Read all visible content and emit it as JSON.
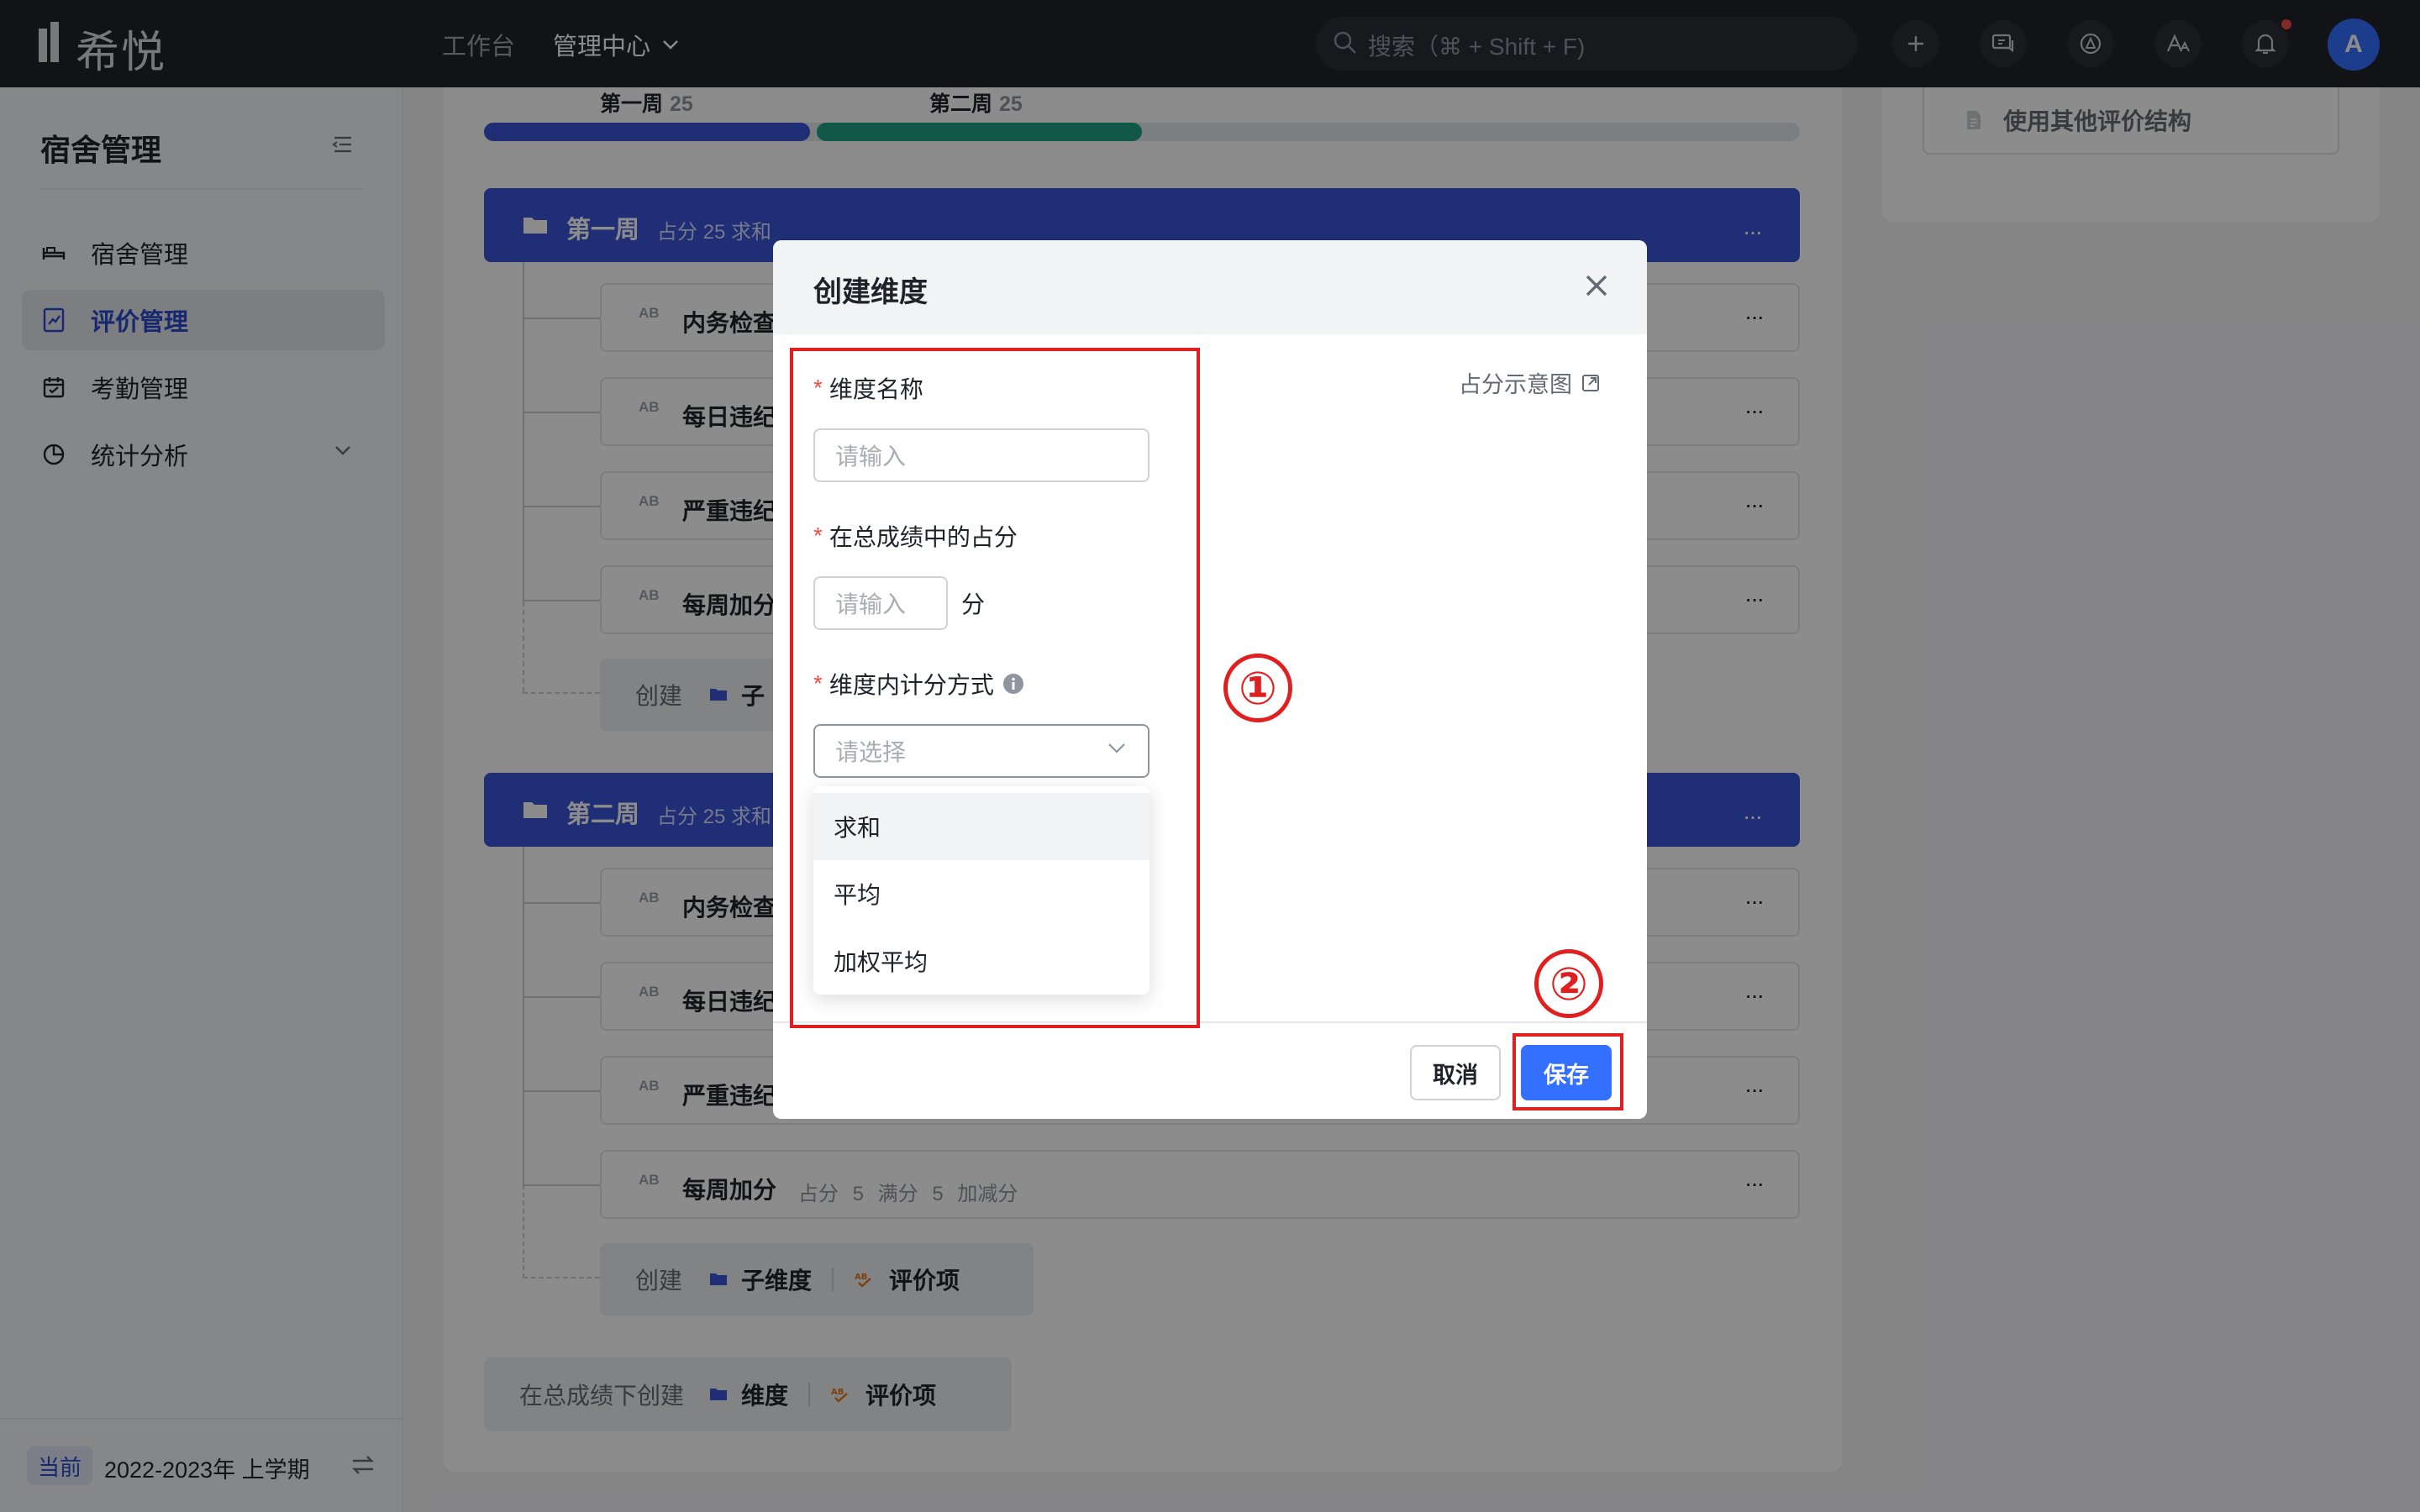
{
  "topbar": {
    "logo_text": "希悦",
    "nav": {
      "workbench": "工作台",
      "admin_center": "管理中心"
    },
    "search_placeholder": "搜索（⌘ + Shift + F)",
    "avatar_initial": "A"
  },
  "sidebar": {
    "title": "宿舍管理",
    "items": [
      {
        "label": "宿舍管理",
        "icon": "bed-icon"
      },
      {
        "label": "评价管理",
        "icon": "evaluation-icon",
        "active": true
      },
      {
        "label": "考勤管理",
        "icon": "calendar-icon"
      },
      {
        "label": "统计分析",
        "icon": "pie-chart-icon",
        "expandable": true
      }
    ],
    "term": {
      "badge": "当前",
      "label": "2022-2023年 上学期"
    }
  },
  "main": {
    "weeks": [
      {
        "label": "第一周",
        "value": "25"
      },
      {
        "label": "第二周",
        "value": "25"
      }
    ],
    "progress": {
      "week1_fraction": 0.25,
      "week2_fraction": 0.25
    },
    "folders": [
      {
        "name": "第一周",
        "meta": "占分 25 求和",
        "items": [
          {
            "name": "内务检查"
          },
          {
            "name": "每日违纪"
          },
          {
            "name": "严重违纪"
          },
          {
            "name": "每周加分"
          }
        ],
        "create": {
          "label": "创建",
          "sub": "子"
        }
      },
      {
        "name": "第二周",
        "meta": "占分 25 求和",
        "items": [
          {
            "name": "内务检查"
          },
          {
            "name": "每日违纪"
          },
          {
            "name": "严重违纪"
          },
          {
            "name": "每周加分",
            "meta": "占分 5   满分 5   加减分"
          }
        ],
        "create": {
          "label": "创建",
          "sub_dimension": "子维度",
          "eval_item": "评价项"
        }
      }
    ],
    "bottom_create": {
      "label": "在总成绩下创建",
      "dimension": "维度",
      "eval_item": "评价项"
    },
    "more_glyph": "···",
    "ab_glyph": "AB"
  },
  "right_panel": {
    "other_structure": "使用其他评价结构"
  },
  "modal": {
    "title": "创建维度",
    "diagram_link": "占分示意图",
    "fields": {
      "name": {
        "label": "维度名称",
        "placeholder": "请输入"
      },
      "score": {
        "label": "在总成绩中的占分",
        "placeholder": "请输入",
        "unit": "分"
      },
      "method": {
        "label": "维度内计分方式",
        "placeholder": "请选择"
      }
    },
    "dropdown_options": [
      "求和",
      "平均",
      "加权平均"
    ],
    "cancel": "取消",
    "save": "保存"
  },
  "annotations": {
    "marker_1": "①",
    "marker_2": "②"
  },
  "colors": {
    "accent": "#3370ff",
    "folder_bar": "#3b55d8",
    "progress_week1": "#3b55d8",
    "progress_week2": "#20a083",
    "annotation_red": "#e02020"
  }
}
